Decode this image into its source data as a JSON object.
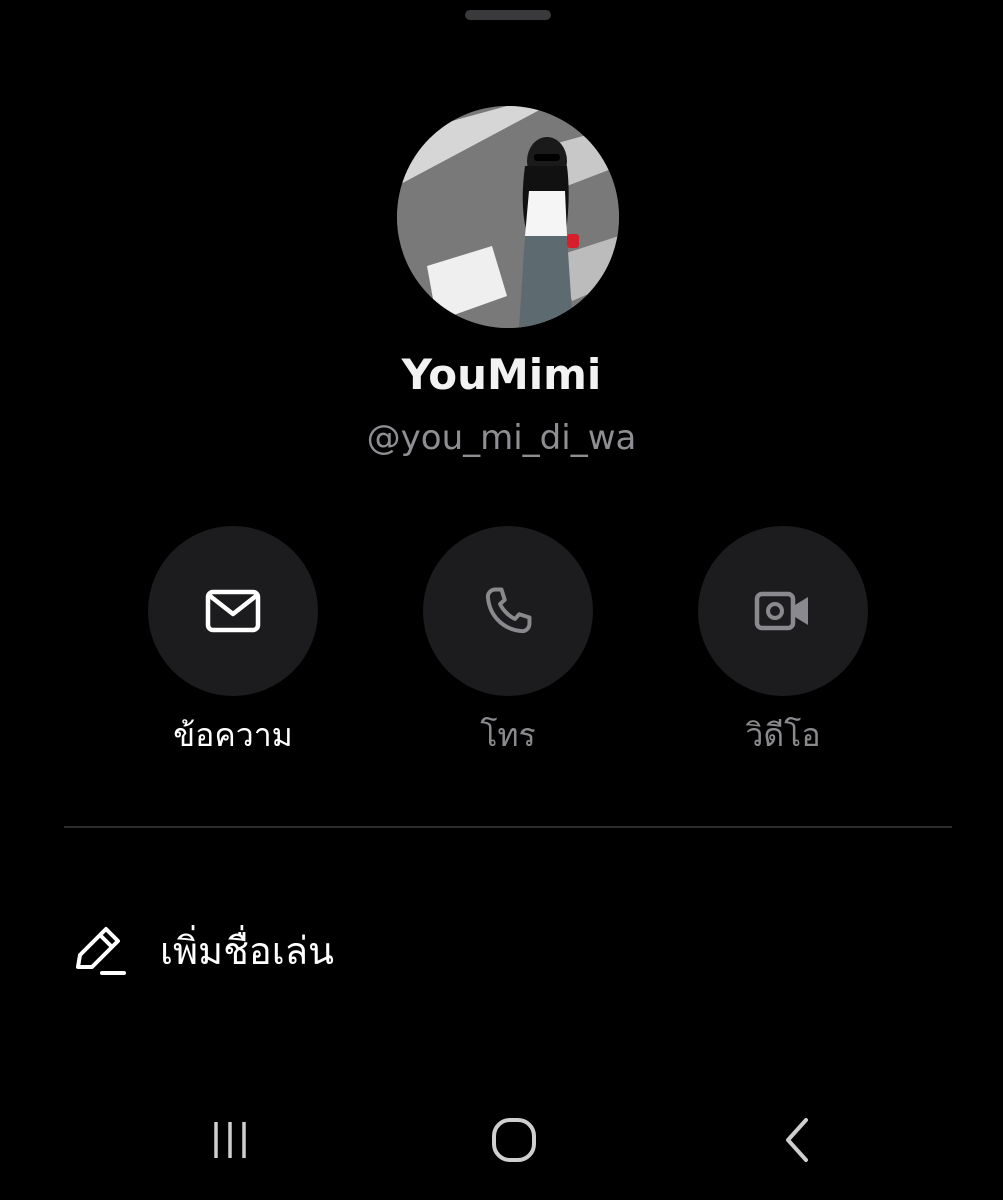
{
  "profile": {
    "display_name": "YouMimi",
    "username": "@you_mi_di_wa",
    "avatar_alt": "profile photo"
  },
  "actions": [
    {
      "id": "message",
      "label": "ข้อความ",
      "icon": "mail-icon"
    },
    {
      "id": "call",
      "label": "โทร",
      "icon": "phone-icon"
    },
    {
      "id": "video",
      "label": "วิดีโอ",
      "icon": "video-camera-icon"
    }
  ],
  "menu": {
    "add_nickname": {
      "label": "เพิ่มชื่อเล่น",
      "icon": "edit-pencil-icon"
    }
  },
  "nav": {
    "recents_icon": "recents-icon",
    "home_icon": "home-icon",
    "back_icon": "back-chevron-icon"
  },
  "colors": {
    "background": "#000000",
    "button_bg": "#1c1c1e",
    "muted_text": "#8e8e93",
    "divider": "#2c2c2e"
  }
}
